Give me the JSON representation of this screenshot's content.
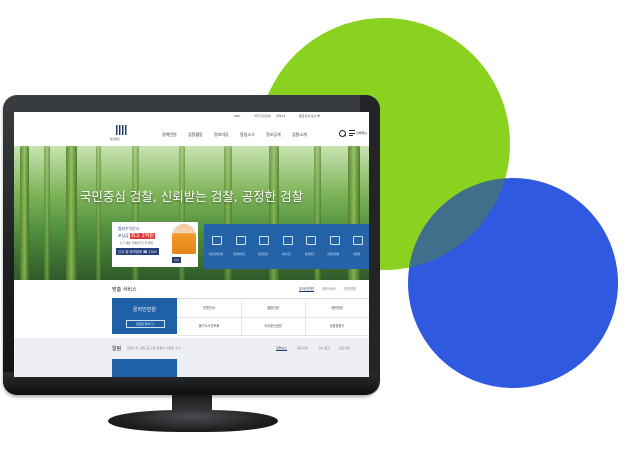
{
  "colors": {
    "green_circle": "#8ad21f",
    "blue_circle": "#2f5adf",
    "brand_navy": "#1f3a6e",
    "brand_blue": "#1f61a8"
  },
  "site": {
    "top_links": [
      "ENG",
      "국가기관검색",
      "정부24",
      "통합검색 옵션 ▼"
    ],
    "logo_text": "대검찰청",
    "nav": [
      "정책민원",
      "검찰활동",
      "정보마당",
      "알림소식",
      "정보공개",
      "검찰소개"
    ],
    "menu_label": "전체메뉴",
    "search_icon": "search-icon",
    "menu_icon": "hamburger-icon"
  },
  "hero": {
    "title": "국민중심 검찰, 신뢰받는 검찰, 공정한 검찰"
  },
  "banner": {
    "line1": "범죄수익은닉",
    "line2_prefix": "포상금",
    "line2_highlight": "최고 1억원",
    "line3": "신고 대상: 범죄수익 은닉 행위",
    "line4": "신고 및 마약범죄 ☎ 1301",
    "pager": "1/3",
    "prev": "‹",
    "next": "›"
  },
  "quick_menu": [
    {
      "icon": "monitor-icon",
      "label": "사건검색조회"
    },
    {
      "icon": "printer-icon",
      "label": "증명서발급"
    },
    {
      "icon": "document-icon",
      "label": "민원신청"
    },
    {
      "icon": "download-icon",
      "label": "서식자료"
    },
    {
      "icon": "car-icon",
      "label": "통계자료"
    },
    {
      "icon": "building-icon",
      "label": "관할검찰청"
    },
    {
      "icon": "chart-icon",
      "label": "검찰청"
    }
  ],
  "services": {
    "title": "맞춤 서비스",
    "tabs": [
      "온라인민원",
      "정보서비스",
      "참여민원"
    ],
    "active_tab": "온라인민원",
    "box_title": "온라인민원",
    "box_button": "민원신청하기 ›",
    "items": [
      "민원안내",
      "열람신청",
      "재판방청",
      "불기소사건조회",
      "자주묻는질문",
      "검찰청찾기"
    ]
  },
  "notice": {
    "title": "알림",
    "subtitle": "검찰소식, 공지 공고 등 검찰의 다양한 소식",
    "tabs": [
      "검찰뉴스",
      "공지사항",
      "고시·공고",
      "보도자료"
    ],
    "active_tab": "검찰뉴스"
  }
}
